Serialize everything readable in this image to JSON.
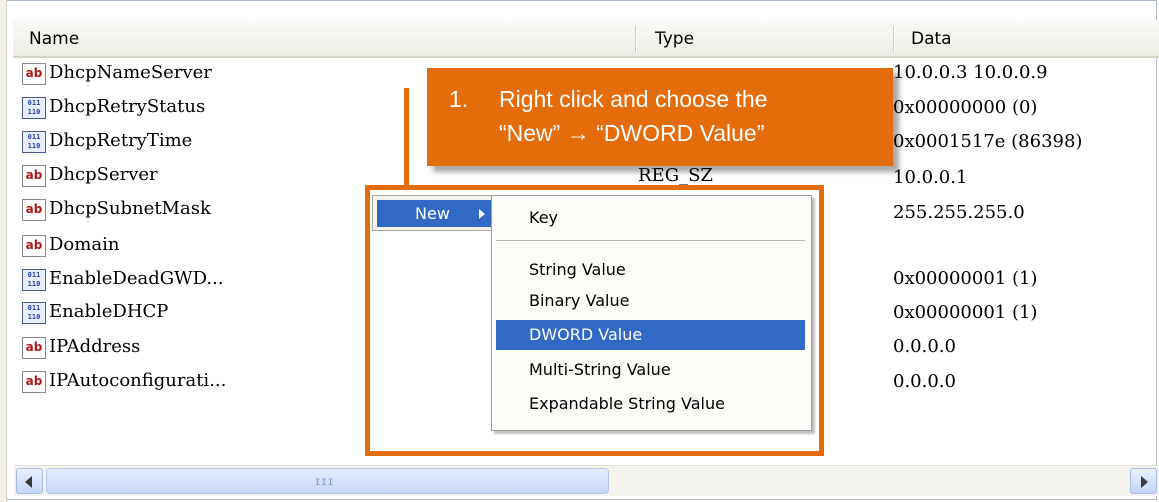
{
  "columns": {
    "name": "Name",
    "type": "Type",
    "data": "Data"
  },
  "rows": [
    {
      "icon": "string-value-icon",
      "icon_text": "ab",
      "name": "DhcpNameServer",
      "type": "",
      "data": "10.0.0.3 10.0.0.9"
    },
    {
      "icon": "binary-value-icon",
      "icon_text": "011\n110",
      "name": "DhcpRetryStatus",
      "type": "",
      "data": "0x00000000 (0)"
    },
    {
      "icon": "binary-value-icon",
      "icon_text": "011\n110",
      "name": "DhcpRetryTime",
      "type": "",
      "data": "0x0001517e (86398)"
    },
    {
      "icon": "string-value-icon",
      "icon_text": "ab",
      "name": "DhcpServer",
      "type": "REG_SZ",
      "data": "10.0.0.1"
    },
    {
      "icon": "string-value-icon",
      "icon_text": "ab",
      "name": "DhcpSubnetMask",
      "type": "",
      "data": "255.255.255.0"
    },
    {
      "icon": "string-value-icon",
      "icon_text": "ab",
      "name": "Domain",
      "type": "",
      "data": ""
    },
    {
      "icon": "binary-value-icon",
      "icon_text": "011\n110",
      "name": "EnableDeadGWD...",
      "type": "",
      "data": "0x00000001 (1)"
    },
    {
      "icon": "binary-value-icon",
      "icon_text": "011\n110",
      "name": "EnableDHCP",
      "type": "",
      "data": "0x00000001 (1)"
    },
    {
      "icon": "string-value-icon",
      "icon_text": "ab",
      "name": "IPAddress",
      "type": "",
      "data": "0.0.0.0"
    },
    {
      "icon": "string-value-icon",
      "icon_text": "ab",
      "name": "IPAutoconfigurati...",
      "type": "",
      "data": "0.0.0.0"
    }
  ],
  "context_menu": {
    "new_label": "New",
    "items": [
      "Key",
      "String Value",
      "Binary Value",
      "DWORD Value",
      "Multi-String Value",
      "Expandable String Value"
    ],
    "selected": "DWORD Value"
  },
  "callout": {
    "number": "1.",
    "line1": "Right click and choose the",
    "line2": "“New” → “DWORD Value”"
  },
  "scrollbar": {
    "grip": "III"
  },
  "colors": {
    "highlight": "#e46c0a",
    "selection": "#316ac5"
  }
}
